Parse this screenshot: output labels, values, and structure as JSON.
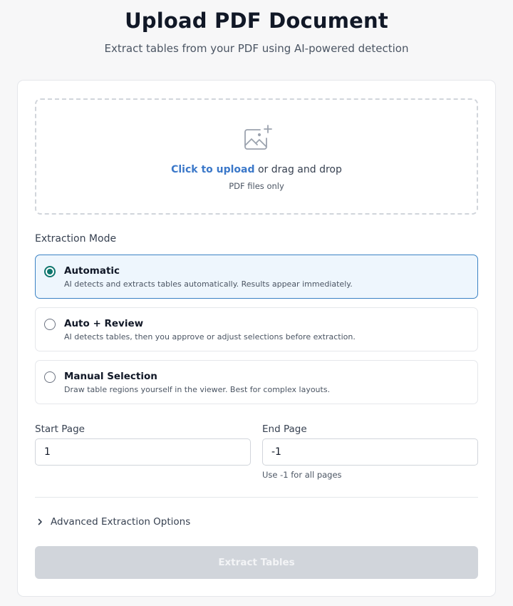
{
  "page": {
    "title": "Upload PDF Document",
    "subtitle": "Extract tables from your PDF using AI-powered detection"
  },
  "upload": {
    "icon": "image-add-icon",
    "link_text": "Click to upload",
    "rest_text": " or drag and drop",
    "hint": "PDF files only"
  },
  "extraction_mode": {
    "label": "Extraction Mode",
    "selected": "automatic",
    "options": [
      {
        "id": "automatic",
        "title": "Automatic",
        "description": "AI detects and extracts tables automatically. Results appear immediately."
      },
      {
        "id": "auto-review",
        "title": "Auto + Review",
        "description": "AI detects tables, then you approve or adjust selections before extraction."
      },
      {
        "id": "manual",
        "title": "Manual Selection",
        "description": "Draw table regions yourself in the viewer. Best for complex layouts."
      }
    ]
  },
  "pages": {
    "start_label": "Start Page",
    "start_value": "1",
    "end_label": "End Page",
    "end_value": "-1",
    "end_hint": "Use -1 for all pages"
  },
  "advanced": {
    "label": "Advanced Extraction Options",
    "icon": "chevron-right-icon"
  },
  "action": {
    "extract_label": "Extract Tables",
    "disabled": true
  },
  "colors": {
    "link": "#3b78c9",
    "selected_border": "#3b82c4",
    "selected_bg": "#eef6fd",
    "radio_active": "#0f766e",
    "button_disabled": "#d1d5db"
  }
}
